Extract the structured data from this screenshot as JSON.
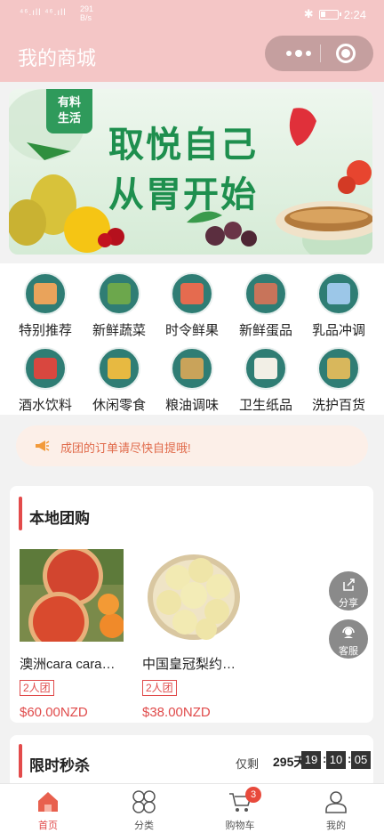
{
  "status_bar": {
    "signal": "⁴⁶.ıll ⁴⁶.ıll",
    "speed_value": "291",
    "speed_unit": "B/s",
    "time": "2:24"
  },
  "header": {
    "title": "我的商城"
  },
  "banner": {
    "badge_line1": "有料",
    "badge_line2": "生活",
    "slogan_line1": "取悦自己",
    "slogan_line2": "从胃开始"
  },
  "categories": [
    {
      "label": "特别推荐",
      "color": "#e9a35b"
    },
    {
      "label": "新鲜蔬菜",
      "color": "#6ca74c"
    },
    {
      "label": "时令鲜果",
      "color": "#e56b4f"
    },
    {
      "label": "新鲜蛋品",
      "color": "#c8745a"
    },
    {
      "label": "乳品冲调",
      "color": "#9cc7e8"
    },
    {
      "label": "酒水饮料",
      "color": "#d9473f"
    },
    {
      "label": "休闲零食",
      "color": "#e7b941"
    },
    {
      "label": "粮油调味",
      "color": "#c9a35a"
    },
    {
      "label": "卫生纸品",
      "color": "#f2efe6"
    },
    {
      "label": "洗护百货",
      "color": "#d8b75c"
    }
  ],
  "notice": {
    "text": "成团的订单请尽快自提哦!"
  },
  "group_buy": {
    "title": "本地团购",
    "products": [
      {
        "name": "澳洲cara cara…",
        "tag": "2人团",
        "price": "$60.00NZD"
      },
      {
        "name": "中国皇冠梨约…",
        "tag": "2人团",
        "price": "$38.00NZD"
      }
    ]
  },
  "floating": {
    "share": "分享",
    "service": "客服"
  },
  "flash_sale": {
    "title": "限时秒杀",
    "remain_label": "仅剩",
    "days": "295天",
    "hours": "19",
    "minutes": "10",
    "seconds": "05"
  },
  "tabbar": {
    "items": [
      {
        "label": "首页"
      },
      {
        "label": "分类"
      },
      {
        "label": "购物车"
      },
      {
        "label": "我的"
      }
    ],
    "cart_badge": "3",
    "active_color": "#e04b4b"
  }
}
